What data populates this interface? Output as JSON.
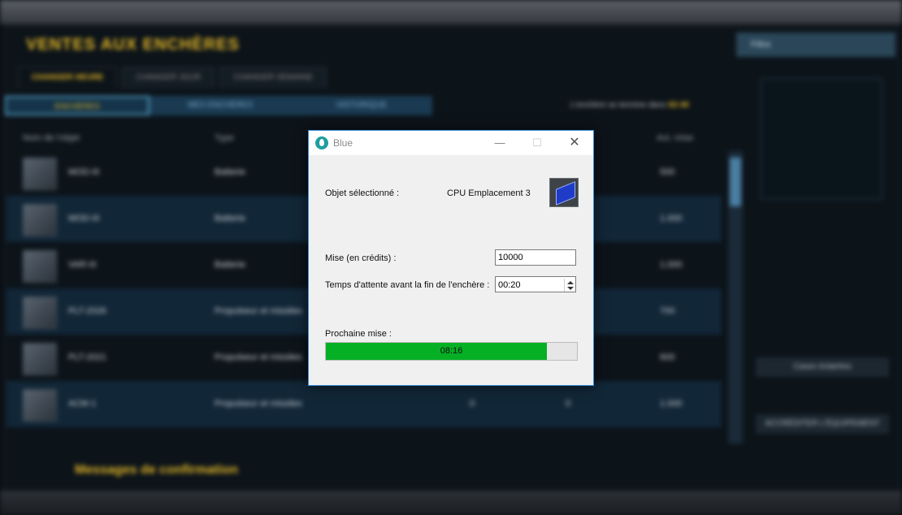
{
  "background": {
    "title": "VENTES AUX ENCHÈRES",
    "tabs": [
      "CHANGER HEURE",
      "CHANGER JOUR",
      "CHANGER SEMAINE"
    ],
    "subtabs": [
      "ENCHÈRES",
      "MES ENCHÈRES",
      "HISTORIQUE"
    ],
    "timer_label": "L'enchère se termine dans",
    "timer_value": "02:40",
    "columns": [
      "Nom de l'objet",
      "Type",
      "",
      "",
      "Act. mise"
    ],
    "rows": [
      {
        "name": "MOD-III",
        "type": "Batterie",
        "c3": "",
        "c4": "",
        "bid": "500"
      },
      {
        "name": "MOD-III",
        "type": "Batterie",
        "c3": "",
        "c4": "",
        "bid": "1.000"
      },
      {
        "name": "VAR-III",
        "type": "Batterie",
        "c3": "",
        "c4": "",
        "bid": "1.000"
      },
      {
        "name": "PLT-2026",
        "type": "Propulseur et missiles",
        "c3": "",
        "c4": "",
        "bid": "700"
      },
      {
        "name": "PLT-2021",
        "type": "Propulseur et missiles",
        "c3": "",
        "c4": "",
        "bid": "600"
      },
      {
        "name": "ACM-1",
        "type": "Propulseur et missiles",
        "c3": "0",
        "c4": "0",
        "bid": "1.000"
      }
    ],
    "confirm_msg": "Messages de confirmation",
    "search_label": "Filtre",
    "right_buttons": [
      "Cases éclairées",
      "ACCRÉDITER L'ÉQUIPEMENT"
    ]
  },
  "dialog": {
    "title": "Blue",
    "selected_label": "Objet sélectionné :",
    "selected_value": "CPU Emplacement 3",
    "item_icon": "cpu-chip-icon",
    "bid_label": "Mise (en crédits) :",
    "bid_value": "10000",
    "wait_label": "Temps d'attente avant la fin de l'enchère :",
    "wait_value": "00:20",
    "next_bid_label": "Prochaine mise :",
    "next_bid_time": "08:16",
    "next_bid_progress": 0.88,
    "progress_color": "#06b025",
    "minimize_glyph": "—",
    "maximize_glyph": "☐",
    "close_glyph": "✕"
  }
}
